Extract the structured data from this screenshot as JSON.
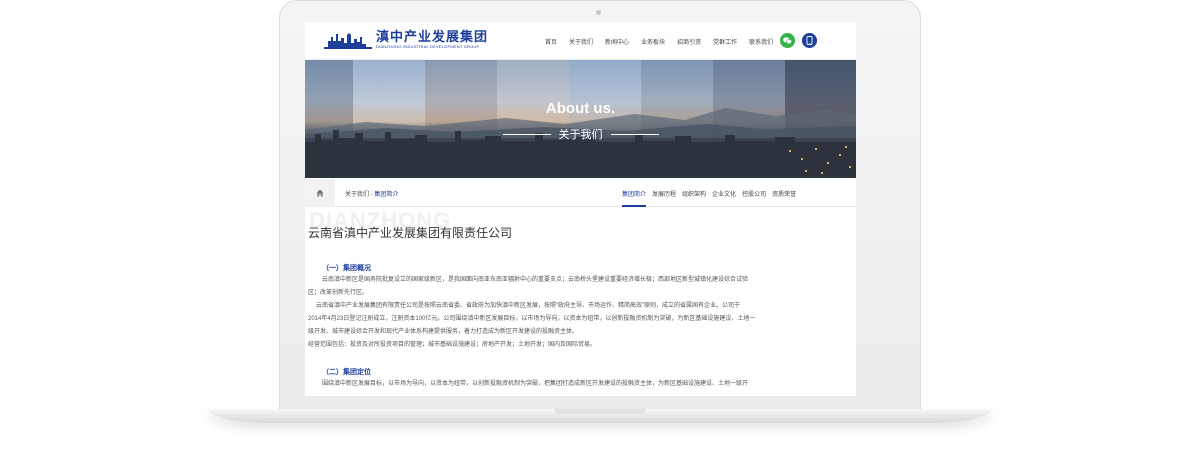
{
  "header": {
    "logo_cn": "滇中产业发展集团",
    "logo_en": "DIANZHONG INDUSTRIAL DEVELOPMENT GROUP",
    "nav": [
      "首页",
      "关于我们",
      "新闻中心",
      "业务板块",
      "招商引资",
      "党群工作",
      "联系我们"
    ]
  },
  "banner": {
    "title_en": "About us.",
    "title_cn": "关于我们"
  },
  "breadcrumb": {
    "parent": "关于我们",
    "separator": " · ",
    "current": "集团简介"
  },
  "subnav": {
    "items": [
      "集团简介",
      "发展历程",
      "组织架构",
      "企业文化",
      "控股公司",
      "资质荣誉"
    ],
    "active_index": 0
  },
  "content": {
    "watermark": "DIANZHONG",
    "company_title": "云南省滇中产业发展集团有限责任公司",
    "section1_title": "（一）集团概况",
    "section1_lines": [
      "云南滇中新区是国务院批复设立的国家级新区，是我国面向南亚东南亚辐射中心的重要支点；云南桥头堡建设重要经济增长极；西部地区新型城镇化建设综合试验",
      "区；改革创新先行区。",
      "云南省滇中产业发展集团有限责任公司是按照云南省委、省政府为加快滇中新区发展，按照“政府主导、市场运作、精简高效”原则，成立的省属国有企业。公司于",
      "2014年4月23日登记注册成立，注册资本100亿元。公司围绕滇中新区发展目标，以市场为导向，以资本为纽带，以创新投融资机制为突破，为新区基础设施建设、土地一",
      "级开发、城市建设综合开发和现代产业体系构建提供服务，着力打造成为新区开发建设的投融资主体。",
      "经营范围包括：投资及对所投资项目的管理；城市基础设施建设；房地产开发；土地开发；国内及国际贸易。"
    ],
    "section2_title": "（二）集团定位",
    "section2_lines": [
      "围绕滇中新区发展目标，以市场为导向，以资本为纽带，以创新投融资机制为突破，把集团打造成新区开发建设的投融资主体，为新区基础设施建设、土地一级开"
    ]
  },
  "colors": {
    "brand_blue": "#1e3e9c",
    "wechat_green": "#35b34a"
  }
}
